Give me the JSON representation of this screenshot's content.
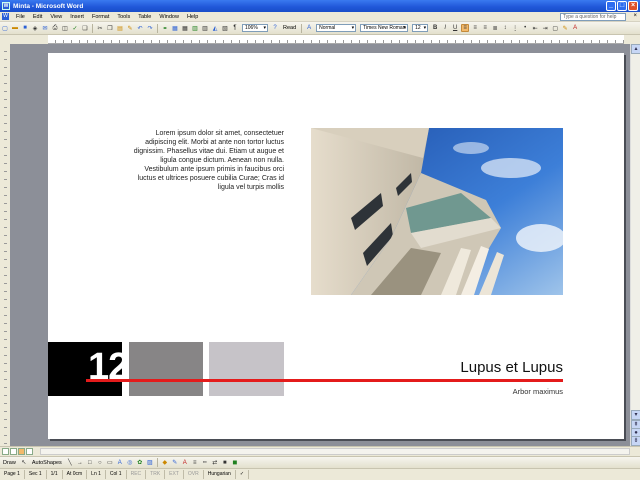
{
  "window": {
    "title": "Minta - Microsoft Word"
  },
  "menu": [
    "File",
    "Edit",
    "View",
    "Insert",
    "Format",
    "Tools",
    "Table",
    "Window",
    "Help"
  ],
  "help_placeholder": "Type a question for help",
  "toolbar": {
    "zoom": "106%",
    "read_label": "Read",
    "style": "Normal",
    "font": "Times New Roman",
    "size": "12"
  },
  "document": {
    "body": "Lorem ipsum dolor sit amet, consectetuer adipiscing elit. Morbi at ante non tortor luctus dignissim. Phasellus vitae dui. Etiam ut augue et ligula congue dictum. Aenean non nulla. Vestibulum ante ipsum primis in faucibus orci luctus et ultrices posuere cubilia Curae; Cras id ligula vel turpis mollis",
    "number": "12",
    "title": "Lupus et Lupus",
    "subtitle": "Arbor maximus"
  },
  "drawbar": {
    "draw": "Draw",
    "autoshapes": "AutoShapes"
  },
  "status": {
    "page": "Page 1",
    "sec": "Sec 1",
    "pages": "1/1",
    "at": "At 0cm",
    "ln": "Ln 1",
    "col": "Col 1",
    "rec": "REC",
    "trk": "TRK",
    "ext": "EXT",
    "ovr": "OVR",
    "language": "Hungarian"
  },
  "colors": {
    "accent_red": "#e41b1b",
    "gray_dark": "#878586",
    "gray_light": "#c6c3c8"
  }
}
